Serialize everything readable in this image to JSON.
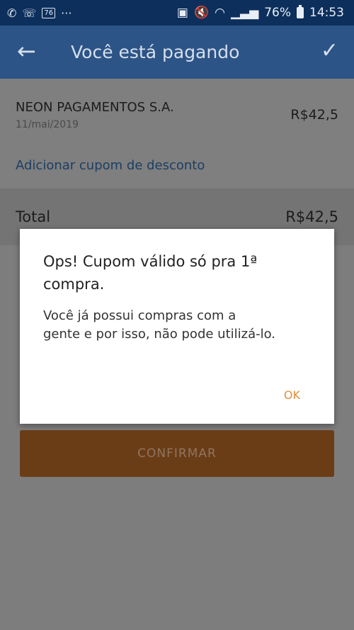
{
  "status_bar": {
    "left_icons": [
      "whatsapp-icon",
      "call-icon",
      "notification-icon"
    ],
    "notification_badge": "76",
    "overflow": "···",
    "battery": "76%",
    "time": "14:53",
    "right_icons": [
      "battery-saver-icon",
      "mute-icon",
      "wifi-icon",
      "signal-icon"
    ]
  },
  "app_bar": {
    "back_icon": "arrow-left-icon",
    "title": "Você está pagando",
    "confirm_icon": "check-icon"
  },
  "payment": {
    "merchant": "NEON PAGAMENTOS S.A.",
    "date": "11/mai/2019",
    "amount": "R$42,5",
    "coupon_link": "Adicionar cupom de desconto",
    "total_label": "Total",
    "total_amount": "R$42,5",
    "confirm_label": "CONFIRMAR"
  },
  "dialog": {
    "title": "Ops! Cupom válido só pra 1ª compra.",
    "message": "Você já possui compras com a gente e por isso, não pode utilizá-lo.",
    "ok_label": "OK"
  },
  "colors": {
    "app_bar": "#2c5487",
    "status_bar": "#0d2f5c",
    "accent": "#e08e3a",
    "link": "#1d3e63"
  }
}
